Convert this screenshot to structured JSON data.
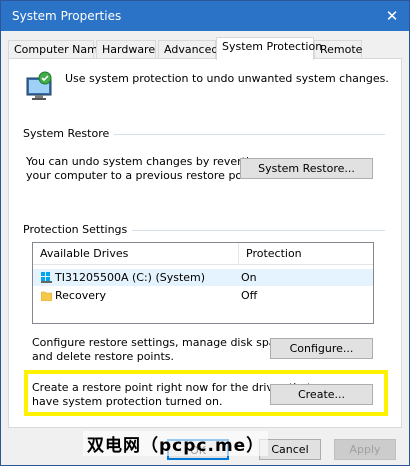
{
  "window": {
    "title": "System Properties",
    "close_glyph": "✕"
  },
  "tabs": [
    {
      "label": "Computer Name"
    },
    {
      "label": "Hardware"
    },
    {
      "label": "Advanced"
    },
    {
      "label": "System Protection"
    },
    {
      "label": "Remote"
    }
  ],
  "intro_text": "Use system protection to undo unwanted system changes.",
  "system_restore": {
    "heading": "System Restore",
    "line1": "You can undo system changes by reverting",
    "line2": "your computer to a previous restore point.",
    "button": "System Restore..."
  },
  "protection": {
    "heading": "Protection Settings",
    "col_drives": "Available Drives",
    "col_protection": "Protection",
    "rows": [
      {
        "drive": "TI31205500A (C:) (System)",
        "protection": "On",
        "icon": "system-drive-icon"
      },
      {
        "drive": "Recovery",
        "protection": "Off",
        "icon": "folder-icon"
      }
    ],
    "configure_line1": "Configure restore settings, manage disk space,",
    "configure_line2": "and delete restore points.",
    "configure_button": "Configure...",
    "create_line1": "Create a restore point right now for the drives that",
    "create_line2": "have system protection turned on.",
    "create_button": "Create..."
  },
  "footer": {
    "ok": "OK",
    "cancel": "Cancel",
    "apply": "Apply"
  },
  "watermark": "双电网（pcpc.me）",
  "colors": {
    "titlebar": "#2b73c7",
    "highlight": "#fff200",
    "accent": "#0078d7"
  }
}
